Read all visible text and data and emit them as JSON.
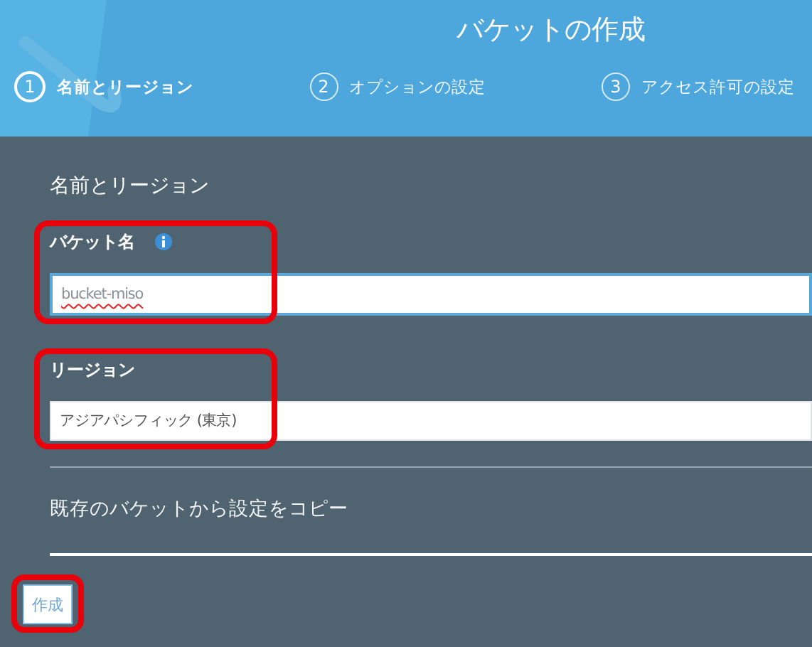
{
  "header": {
    "title": "バケットの作成"
  },
  "steps": [
    {
      "number": "1",
      "label": "名前とリージョン",
      "selected": true
    },
    {
      "number": "2",
      "label": "オプションの設定",
      "selected": false
    },
    {
      "number": "3",
      "label": "アクセス許可の設定",
      "selected": false
    }
  ],
  "section": {
    "heading": "名前とリージョン"
  },
  "fields": [
    {
      "kind": "text",
      "label": "バケット名",
      "info": true,
      "value": "bucket-miso",
      "highlighted": true
    },
    {
      "kind": "select",
      "label": "リージョン",
      "info": false,
      "value": "アジアパシフィック (東京)",
      "highlighted": true
    }
  ],
  "copy_settings": {
    "label": "既存のバケットから設定をコピー"
  },
  "create_button": {
    "label": "作成",
    "highlighted": true
  }
}
